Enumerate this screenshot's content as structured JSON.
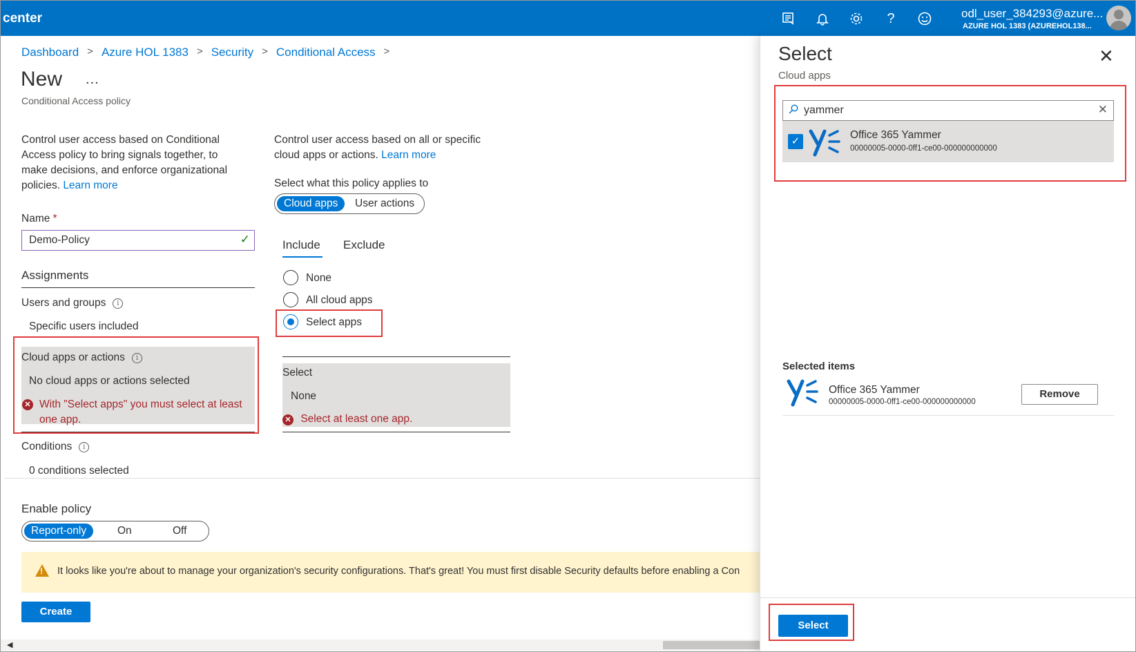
{
  "topbar": {
    "brand": "center",
    "user_name": "odl_user_384293@azure...",
    "user_tenant": "AZURE HOL 1383 (AZUREHOL138...",
    "icons": [
      "feedback-directory-icon",
      "bell-icon",
      "gear-icon",
      "help-icon",
      "smiley-icon"
    ]
  },
  "breadcrumb": [
    "Dashboard",
    "Azure HOL 1383",
    "Security",
    "Conditional Access"
  ],
  "page": {
    "title": "New",
    "more": "...",
    "subtitle": "Conditional Access policy"
  },
  "left": {
    "description": "Control user access based on Conditional Access policy to bring signals together, to make decisions, and enforce organizational policies.",
    "learn_more": "Learn more",
    "name_label": "Name",
    "name_required": "*",
    "name_value": "Demo-Policy",
    "assignments": "Assignments",
    "users_groups_label": "Users and groups",
    "users_groups_value": "Specific users included",
    "cloud_apps_label": "Cloud apps or actions",
    "cloud_apps_value": "No cloud apps or actions selected",
    "cloud_apps_error": "With \"Select apps\" you must select at least one app.",
    "conditions_label": "Conditions",
    "conditions_value": "0 conditions selected"
  },
  "middle": {
    "description": "Control user access based on all or specific cloud apps or actions.",
    "learn_more": "Learn more",
    "applies_label": "Select what this policy applies to",
    "toggle": [
      "Cloud apps",
      "User actions"
    ],
    "tabs": [
      "Include",
      "Exclude"
    ],
    "radios": [
      "None",
      "All cloud apps",
      "Select apps"
    ],
    "select_label": "Select",
    "select_value": "None",
    "select_error": "Select at least one app."
  },
  "enable_policy": {
    "label": "Enable policy",
    "options": [
      "Report-only",
      "On",
      "Off"
    ]
  },
  "warning": "It looks like you're about to manage your organization's security configurations. That's great! You must first disable Security defaults before enabling a Con",
  "create_label": "Create",
  "panel": {
    "title": "Select",
    "subtitle": "Cloud apps",
    "close": "✕",
    "search_value": "yammer",
    "result": {
      "name": "Office 365 Yammer",
      "id": "00000005-0000-0ff1-ce00-000000000000"
    },
    "selected_title": "Selected items",
    "selected_item": {
      "name": "Office 365 Yammer",
      "id": "00000005-0000-0ff1-ce00-000000000000"
    },
    "remove_label": "Remove",
    "select_label": "Select"
  },
  "colors": {
    "topbar": "#0072c6",
    "accent": "#0078d4",
    "error": "#a4262c",
    "highlight": "#e03c3c",
    "warning_bg": "#fff4ce"
  }
}
